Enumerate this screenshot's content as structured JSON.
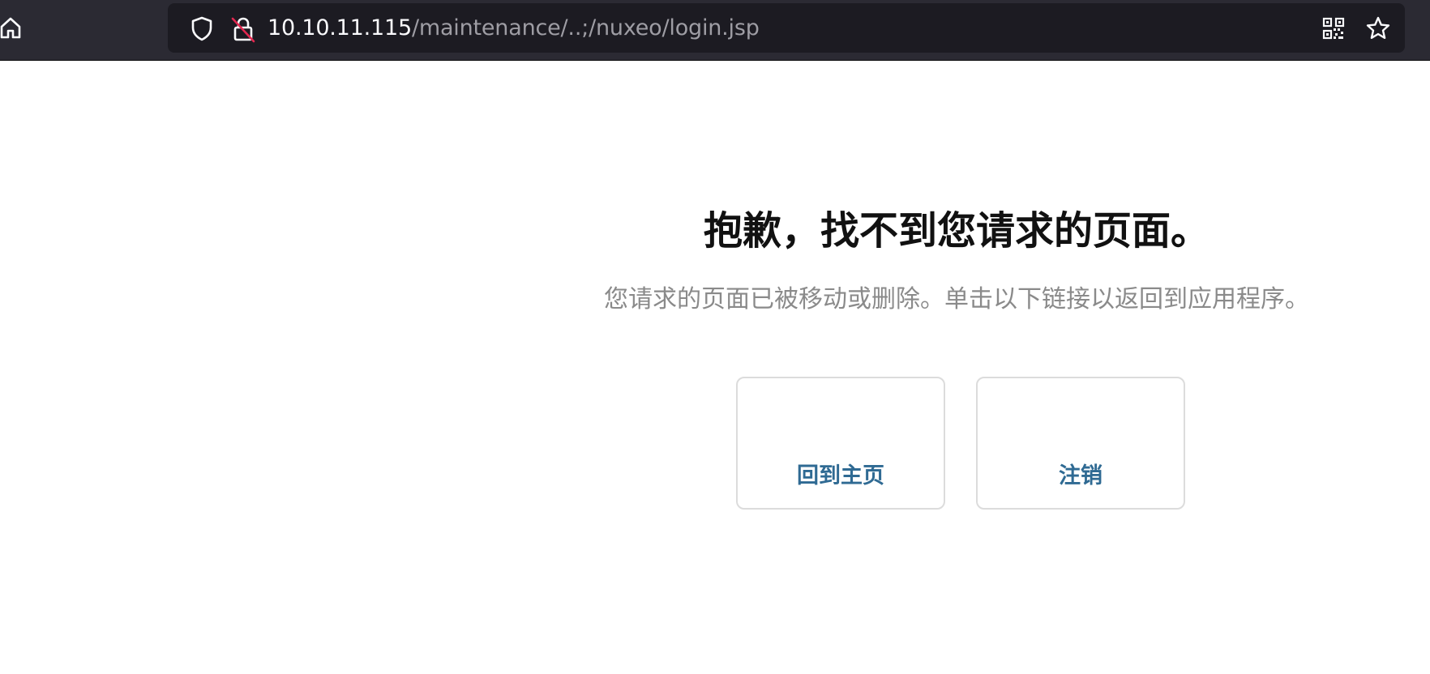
{
  "browser": {
    "url_host": "10.10.11.115",
    "url_path": "/maintenance/..;/nuxeo/login.jsp",
    "icons": {
      "home": "home-icon",
      "shield": "tracking-protection-shield-icon",
      "lock": "insecure-lock-icon",
      "qr": "qr-code-icon",
      "star": "bookmark-star-icon"
    },
    "colors": {
      "toolbar": "#2b2a33",
      "urlbar": "#1c1b22",
      "url_host": "#fbfbfe",
      "url_path": "#9e9da4",
      "insecure_strike": "#e22850"
    }
  },
  "page": {
    "title": "抱歉，找不到您请求的页面。",
    "subtitle": "您请求的页面已被移动或删除。单击以下链接以返回到应用程序。",
    "actions": [
      {
        "label": "回到主页"
      },
      {
        "label": "注销"
      }
    ],
    "colors": {
      "title": "#111111",
      "subtitle": "#8a8a8a",
      "link": "#2f6a93",
      "card_border": "#dcdcdc"
    }
  }
}
